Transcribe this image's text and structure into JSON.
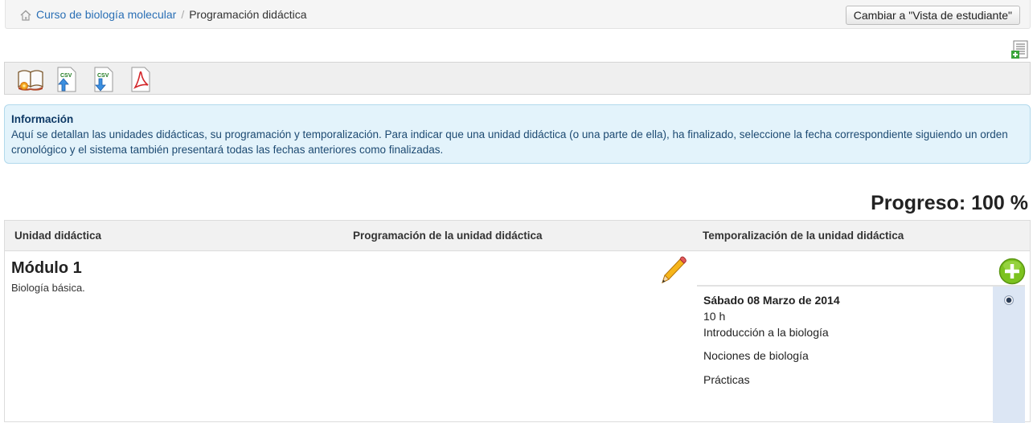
{
  "breadcrumb": {
    "course": "Curso de biología molecular",
    "separator": "/",
    "current": "Programación didáctica"
  },
  "switch_view_label": "Cambiar a \"Vista de estudiante\"",
  "toolbar": {
    "icons": [
      "book-icon",
      "csv-import-icon",
      "csv-export-icon",
      "pdf-icon"
    ],
    "csv_label": "CSV"
  },
  "info": {
    "title": "Información",
    "text": "Aquí se detallan las unidades didácticas, su programación y temporalización. Para indicar que una unidad didáctica (o una parte de ella), ha finalizado, seleccione la fecha correspondiente siguiendo un orden cronológico y el sistema también presentará todas las fechas anteriores como finalizadas."
  },
  "progress": "Progreso: 100 %",
  "progress_value": 100,
  "table": {
    "headers": [
      "Unidad didáctica",
      "Programación de la unidad didáctica",
      "Temporalización de la unidad didáctica"
    ],
    "rows": [
      {
        "title": "Módulo 1",
        "description": "Biología básica.",
        "schedule": {
          "date": "Sábado 08 Marzo de 2014",
          "duration": "10 h",
          "items": [
            "Introducción a la biología",
            "Nociones de biología",
            "Prácticas"
          ],
          "done": true
        }
      }
    ]
  },
  "colors": {
    "link": "#2a6fb5",
    "info_bg": "#e3f3fb",
    "info_border": "#b2d9ec",
    "schedule_col": "#dce6f4",
    "add_green": "#7cc21f"
  }
}
